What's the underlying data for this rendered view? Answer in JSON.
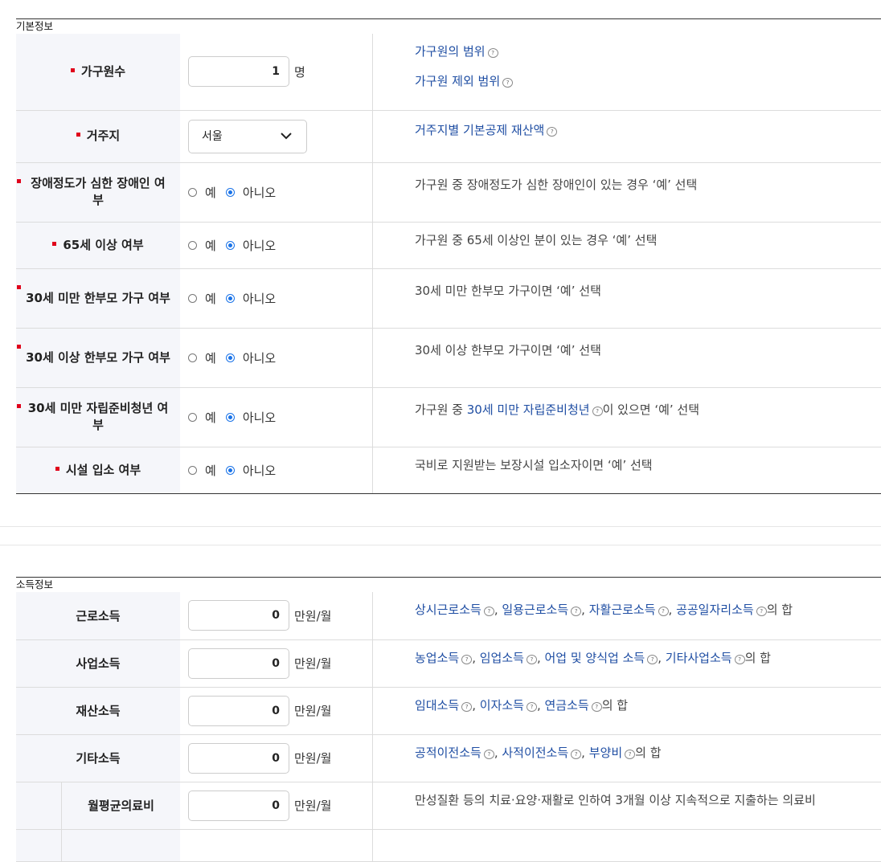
{
  "basic": {
    "title": "기본정보",
    "household": {
      "label": "가구원수",
      "value": "1",
      "unit": "명",
      "link1": "가구원의 범위",
      "link2": "가구원 제외 범위"
    },
    "residence": {
      "label": "거주지",
      "value": "서울",
      "link": "거주지별 기본공제 재산액"
    },
    "radio_labels": {
      "yes": "예",
      "no": "아니오"
    },
    "disabled": {
      "label": "장애정도가 심한 장애인 여부",
      "desc": "가구원 중 장애정도가 심한 장애인이 있는 경우 ‘예’ 선택"
    },
    "over65": {
      "label": "65세 이상 여부",
      "desc": "가구원 중 65세 이상인 분이 있는 경우 ‘예’ 선택"
    },
    "single_under30": {
      "label": "30세 미만 한부모 가구 여부",
      "desc": "30세 미만 한부모 가구이면 ‘예’ 선택"
    },
    "single_over30": {
      "label": "30세 이상 한부모 가구 여부",
      "desc": "30세 이상 한부모 가구이면 ‘예’ 선택"
    },
    "youth": {
      "label": "30세 미만 자립준비청년 여부",
      "desc_prefix": "가구원 중 ",
      "desc_link": "30세 미만 자립준비청년",
      "desc_suffix": "이 있으면 ‘예’ 선택"
    },
    "facility": {
      "label": "시설 입소 여부",
      "desc": "국비로 지원받는 보장시설 입소자이면 ‘예’ 선택"
    }
  },
  "income": {
    "title": "소득정보",
    "unit": "만원/월",
    "earned": {
      "label": "근로소득",
      "value": "0",
      "links": [
        "상시근로소득",
        "일용근로소득",
        "자활근로소득",
        "공공일자리소득"
      ],
      "suffix": "의 합"
    },
    "business": {
      "label": "사업소득",
      "value": "0",
      "links": [
        "농업소득",
        "임업소득",
        "어업 및 양식업 소득",
        "기타사업소득"
      ],
      "suffix": "의 합"
    },
    "property": {
      "label": "재산소득",
      "value": "0",
      "links": [
        "임대소득",
        "이자소득",
        "연금소득"
      ],
      "suffix": "의 합"
    },
    "other": {
      "label": "기타소득",
      "value": "0",
      "links": [
        "공적이전소득",
        "사적이전소득",
        "부양비"
      ],
      "suffix": "의 합"
    },
    "medical": {
      "label": "월평균의료비",
      "value": "0",
      "desc": "만성질환 등의 치료·요양·재활로 인하여 3개월 이상 지속적으로 지출하는 의료비"
    }
  }
}
